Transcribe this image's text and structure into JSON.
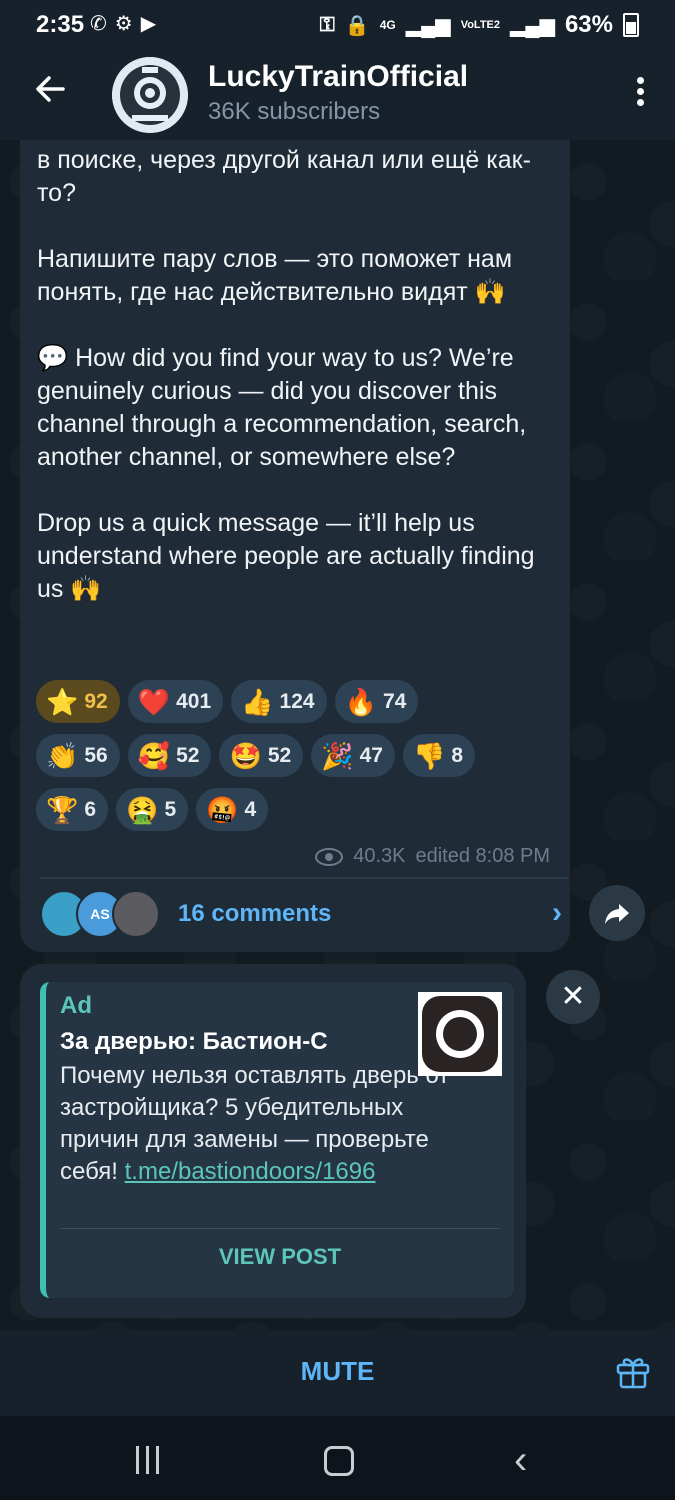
{
  "status": {
    "time": "2:35",
    "network_4g": "4G",
    "network_lte": "VoLTE2",
    "battery": "63%"
  },
  "header": {
    "title": "LuckyTrainOfficial",
    "subtitle": "36K subscribers"
  },
  "post": {
    "text": "в поиске, через другой канал или ещё как-то?\n\nНапишите пару слов — это поможет нам понять, где нас действительно видят 🙌\n\n💬 How did you find your way to us? We’re genuinely curious — did you discover this channel through a recommendation, search, another channel, or somewhere else?\n\nDrop us a quick message — it’ll help us understand where people are actually finding us 🙌",
    "reactions": [
      {
        "emoji": "⭐",
        "count": "92"
      },
      {
        "emoji": "❤️",
        "count": "401"
      },
      {
        "emoji": "👍",
        "count": "124"
      },
      {
        "emoji": "🔥",
        "count": "74"
      },
      {
        "emoji": "👏",
        "count": "56"
      },
      {
        "emoji": "🥰",
        "count": "52"
      },
      {
        "emoji": "🤩",
        "count": "52"
      },
      {
        "emoji": "🎉",
        "count": "47"
      },
      {
        "emoji": "👎",
        "count": "8"
      },
      {
        "emoji": "🏆",
        "count": "6"
      },
      {
        "emoji": "🤮",
        "count": "5"
      },
      {
        "emoji": "🤬",
        "count": "4"
      }
    ],
    "views": "40.3K",
    "edited": "edited 8:08 PM",
    "comments_avatar_initials": "AS",
    "comments_label": "16 comments"
  },
  "ad": {
    "label": "Ad",
    "title": "За дверью: Бастион-С",
    "body": "Почему нельзя оставлять дверь от застройщика? 5 убедительных причин для замены — проверьте себя! ",
    "link": "t.me/bastiondoors/1696",
    "cta": "VIEW POST"
  },
  "bottom": {
    "mute_label": "MUTE"
  },
  "colors": {
    "accent": "#5eb5f7",
    "ad_accent": "#5cc6bb",
    "bubble": "#1f2c38",
    "header": "#17212b"
  }
}
